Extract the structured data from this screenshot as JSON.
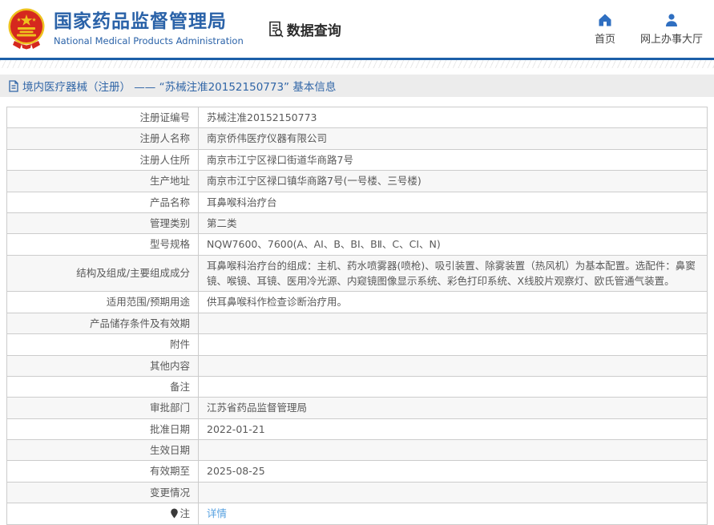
{
  "header": {
    "org_name_zh": "国家药品监督管理局",
    "org_name_en": "National Medical Products Administration",
    "nav_data_query": "数据查询",
    "nav_home": "首页",
    "nav_service_hall": "网上办事大厅"
  },
  "breadcrumb": {
    "text": "境内医疗器械（注册） —— “苏械注准20152150773” 基本信息"
  },
  "info_table": {
    "rows": [
      {
        "label": "注册证编号",
        "value": "苏械注准20152150773"
      },
      {
        "label": "注册人名称",
        "value": "南京侨伟医疗仪器有限公司"
      },
      {
        "label": "注册人住所",
        "value": "南京市江宁区禄口街道华商路7号"
      },
      {
        "label": "生产地址",
        "value": "南京市江宁区禄口镇华商路7号(一号楼、三号楼)"
      },
      {
        "label": "产品名称",
        "value": "耳鼻喉科治疗台"
      },
      {
        "label": "管理类别",
        "value": "第二类"
      },
      {
        "label": "型号规格",
        "value": "NQW7600、7600(A、AI、B、BI、BⅡ、C、CI、N)"
      },
      {
        "label": "结构及组成/主要组成成分",
        "value": "耳鼻喉科治疗台的组成：主机、药水喷雾器(喷枪)、吸引装置、除雾装置（热风机）为基本配置。选配件：鼻窦镜、喉镜、耳镜、医用冷光源、内窥镜图像显示系统、彩色打印系统、X线胶片观察灯、欧氏管通气装置。"
      },
      {
        "label": "适用范围/预期用途",
        "value": "供耳鼻喉科作检查诊断治疗用。"
      },
      {
        "label": "产品储存条件及有效期",
        "value": ""
      },
      {
        "label": "附件",
        "value": ""
      },
      {
        "label": "其他内容",
        "value": ""
      },
      {
        "label": "备注",
        "value": ""
      },
      {
        "label": "审批部门",
        "value": "江苏省药品监督管理局"
      },
      {
        "label": "批准日期",
        "value": "2022-01-21"
      },
      {
        "label": "生效日期",
        "value": ""
      },
      {
        "label": "有效期至",
        "value": "2025-08-25"
      },
      {
        "label": "变更情况",
        "value": ""
      },
      {
        "label": "注",
        "value": "详情",
        "icon": "pin",
        "link": true
      }
    ]
  },
  "colors": {
    "brand_blue": "#2a62a8",
    "divider_blue": "#1c5fa8",
    "breadcrumb_bg": "#ececec",
    "breadcrumb_text": "#3166a7",
    "table_border": "#cccccc",
    "row_alt_bg": "#f7f7f7",
    "text": "#595959",
    "link_blue": "#55a0e0",
    "emblem_red": "#d5281e",
    "emblem_gold": "#eec11e"
  }
}
